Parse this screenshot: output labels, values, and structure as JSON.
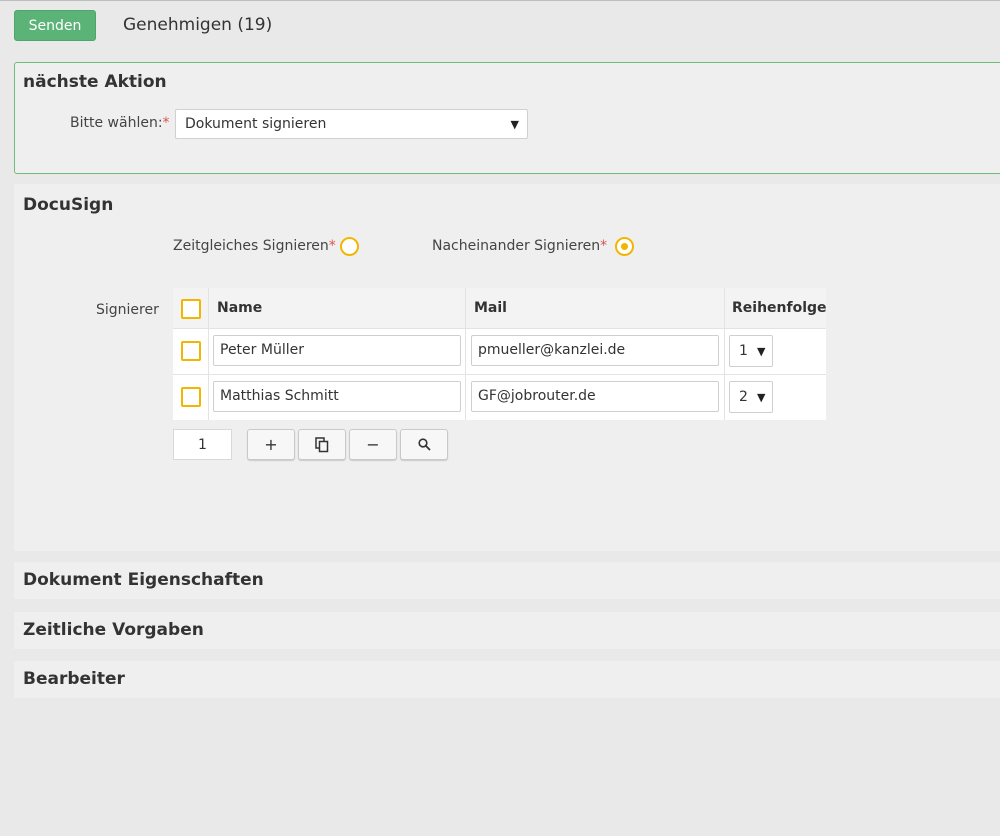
{
  "toolbar": {
    "send_label": "Senden",
    "title": "Genehmigen (19)"
  },
  "next_action": {
    "title": "nächste Aktion",
    "choose_label": "Bitte wählen:",
    "required_mark": "*",
    "selected": "Dokument signieren"
  },
  "docusign": {
    "title": "DocuSign",
    "radio_simultaneous_label": "Zeitgleiches Signieren",
    "radio_sequential_label": "Nacheinander Signieren",
    "radio_selected": "sequential",
    "signers_label": "Signierer",
    "table": {
      "headers": [
        "Name",
        "Mail",
        "Reihenfolge"
      ],
      "rows": [
        {
          "name": "Peter Müller",
          "mail": "pmueller@kanzlei.de",
          "order": "1"
        },
        {
          "name": "Matthias Schmitt",
          "mail": "GF@jobrouter.de",
          "order": "2"
        }
      ]
    },
    "page_number": "1"
  },
  "sections": {
    "document_properties": "Dokument Eigenschaften",
    "time_constraints": "Zeitliche Vorgaben",
    "editor": "Bearbeiter"
  },
  "colors": {
    "accent_green": "#5cb377",
    "checkbox_yellow": "#f2b600",
    "required_red": "#d9534f"
  },
  "icons": {
    "add": "plus-icon",
    "copy": "copy-icon",
    "remove": "minus-icon",
    "search": "search-icon",
    "dropdown": "caret-down-icon"
  }
}
